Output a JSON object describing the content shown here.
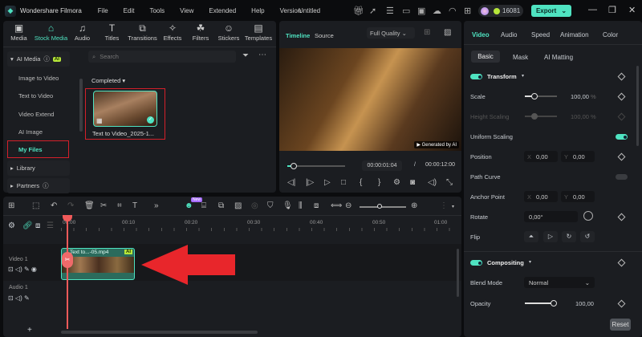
{
  "app": {
    "name": "Wondershare Filmora",
    "doc_title": "Untitled",
    "credits": "16081",
    "export_label": "Export",
    "menu": [
      "File",
      "Edit",
      "Tools",
      "View",
      "Extended",
      "Help",
      "Version"
    ],
    "top_icons": [
      "gift-icon",
      "rocket-icon",
      "task-icon",
      "layout-icon",
      "save-icon",
      "cloud-icon",
      "headset-icon",
      "apps-icon"
    ]
  },
  "media_tabs": [
    {
      "label": "Media",
      "icon": "▣"
    },
    {
      "label": "Stock Media",
      "icon": "⌂"
    },
    {
      "label": "Audio",
      "icon": "♫"
    },
    {
      "label": "Titles",
      "icon": "T"
    },
    {
      "label": "Transitions",
      "icon": "⧉"
    },
    {
      "label": "Effects",
      "icon": "✧"
    },
    {
      "label": "Filters",
      "icon": "☘"
    },
    {
      "label": "Stickers",
      "icon": "☺"
    },
    {
      "label": "Templates",
      "icon": "▤"
    }
  ],
  "sidebar": {
    "ai_media": "AI Media",
    "ai_badge": "AI",
    "items": [
      "Image to Video",
      "Text to Video",
      "Video Extend",
      "AI Image",
      "My Files"
    ],
    "library": "Library",
    "partners": "Partners"
  },
  "browser": {
    "search_placeholder": "Search",
    "filter": "Completed",
    "file_name": "Text to Video_2025-1..."
  },
  "preview": {
    "tab_timeline": "Timeline",
    "tab_source": "Source",
    "quality": "Full Quality",
    "watermark": "Generated by AI",
    "current_time": "00:00:01:04",
    "separator": "/",
    "total_time": "00:00:12:00",
    "progress": 0.09
  },
  "properties": {
    "tabs": [
      "Video",
      "Audio",
      "Speed",
      "Animation",
      "Color"
    ],
    "subtabs": [
      "Basic",
      "Mask",
      "AI Matting"
    ],
    "transform": "Transform",
    "scale_label": "Scale",
    "scale_value": "100,00",
    "scale_unit": "%",
    "height_label": "Height Scaling",
    "height_value": "100,00",
    "height_unit": "%",
    "uniform": "Uniform Scaling",
    "position_label": "Position",
    "pos_x": "0,00",
    "pos_y": "0,00",
    "path_curve": "Path Curve",
    "anchor_label": "Anchor Point",
    "anchor_x": "0,00",
    "anchor_y": "0,00",
    "x": "X",
    "y": "Y",
    "rotate_label": "Rotate",
    "rotate_value": "0,00°",
    "flip_label": "Flip",
    "compositing": "Compositing",
    "blend_label": "Blend Mode",
    "blend_value": "Normal",
    "opacity_label": "Opacity",
    "opacity_value": "100,00",
    "reset": "Reset"
  },
  "timeline": {
    "ruler": [
      "00:00",
      "00:10",
      "00:20",
      "00:30",
      "00:40",
      "00:50",
      "01:00"
    ],
    "video_track": "Video 1",
    "audio_track": "Audio 1",
    "clip_name": "Text to...-05.mp4",
    "clip_badge": "AI",
    "new_badge": "New"
  },
  "colors": {
    "accent": "#4fe3c1",
    "highlight": "#d4202a",
    "playhead": "#f05a5a"
  }
}
